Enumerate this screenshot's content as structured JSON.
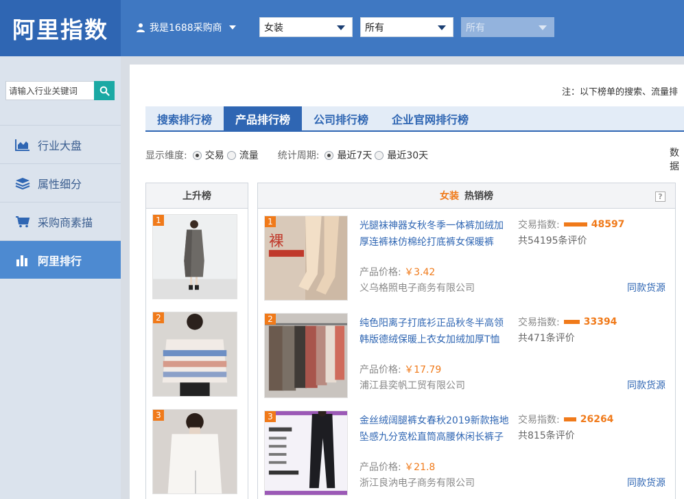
{
  "header": {
    "logo": "阿里指数",
    "user_label": "我是1688采购商",
    "select_category": "女装",
    "select_sub": "所有",
    "select_third": "所有"
  },
  "sidebar": {
    "search_placeholder": "请输入行业关键词",
    "items": [
      {
        "label": "行业大盘",
        "icon": "chart-area-icon"
      },
      {
        "label": "属性细分",
        "icon": "layers-icon"
      },
      {
        "label": "采购商素描",
        "icon": "cart-icon"
      },
      {
        "label": "阿里排行",
        "icon": "bar-chart-icon"
      }
    ]
  },
  "main": {
    "note": "注：以下榜单的搜索、流量排",
    "tabs": [
      "搜索排行榜",
      "产品排行榜",
      "公司排行榜",
      "企业官网排行榜"
    ],
    "active_tab": "产品排行榜",
    "filters": {
      "dimension_label": "显示维度:",
      "dimension_options": [
        "交易",
        "流量"
      ],
      "period_label": "统计周期:",
      "period_options": [
        "最近7天",
        "最近30天"
      ]
    },
    "data_tag": "数据"
  },
  "rise_list": {
    "title": "上升榜",
    "items": [
      {
        "rank": "1"
      },
      {
        "rank": "2"
      },
      {
        "rank": "3"
      }
    ]
  },
  "hot_list": {
    "category": "女装",
    "title": "热销榜",
    "help": "?",
    "index_label": "交易指数:",
    "price_label": "产品价格:",
    "same_source": "同款货源",
    "items": [
      {
        "rank": "1",
        "title": "光腿袜神器女秋冬季一体裤加绒加厚连裤袜仿棉纶打底裤女保暖裤",
        "index": "48597",
        "index_ratio": 1.0,
        "reviews": "共54195条评价",
        "price": "￥3.42",
        "company": "义乌格照电子商务有限公司"
      },
      {
        "rank": "2",
        "title": "纯色阳离子打底衫正品秋冬半高领韩版德绒保暖上衣女加绒加厚T恤",
        "index": "33394",
        "index_ratio": 0.69,
        "reviews": "共471条评价",
        "price": "￥17.79",
        "company": "浦江县奕帆工贸有限公司"
      },
      {
        "rank": "3",
        "title": "金丝绒阔腿裤女春秋2019新款拖地坠感九分宽松直筒高腰休闲长裤子",
        "index": "26264",
        "index_ratio": 0.54,
        "reviews": "共815条评价",
        "price": "￥21.8",
        "company": "浙江良汭电子商务有限公司"
      }
    ]
  },
  "colors": {
    "header_bg": "#3f78c2",
    "logo_bg": "#2f66b3",
    "accent_orange": "#f07a1a",
    "link_blue": "#2f66b3",
    "search_btn": "#1aa9a4",
    "nav_active": "#4d8ad1"
  }
}
